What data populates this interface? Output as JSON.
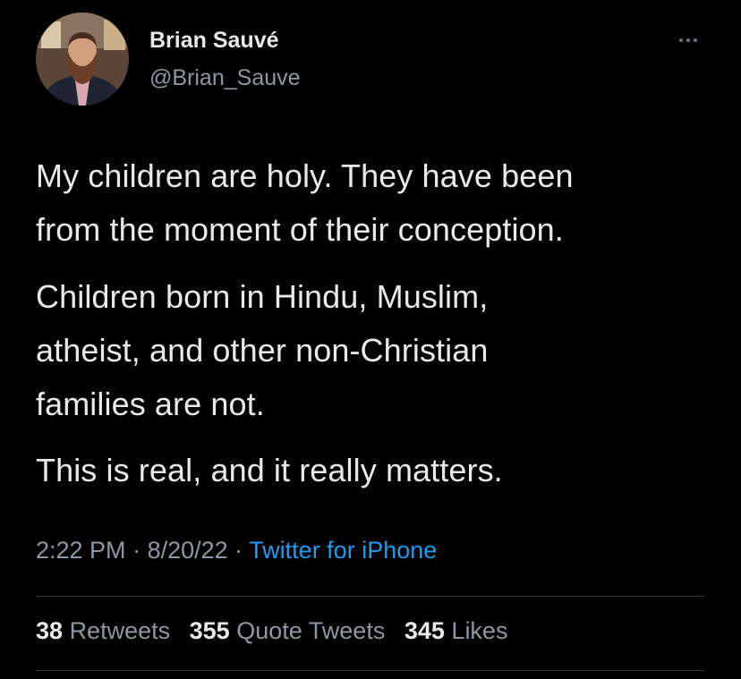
{
  "author": {
    "name": "Brian Sauvé",
    "handle": "@Brian_Sauve"
  },
  "tweet": {
    "paragraphs": [
      [
        "My children are holy. They have been",
        "from the moment of their conception."
      ],
      [
        "Children born in Hindu, Muslim,",
        "atheist, and other non-Christian",
        "families are not."
      ],
      [
        "This is real, and it really matters."
      ]
    ]
  },
  "meta": {
    "time": "2:22 PM",
    "separator": " · ",
    "date": "8/20/22",
    "source": "Twitter for iPhone"
  },
  "stats": {
    "retweets_count": "38",
    "retweets_label": "Retweets",
    "quotes_count": "355",
    "quotes_label": "Quote Tweets",
    "likes_count": "345",
    "likes_label": "Likes"
  },
  "colors": {
    "background": "#000000",
    "primary_text": "#e7e9ea",
    "secondary_text": "#8b98a5",
    "link": "#1d9bf0",
    "divider": "#2f3336"
  },
  "icons": {
    "more": "more-horizontal-icon"
  }
}
